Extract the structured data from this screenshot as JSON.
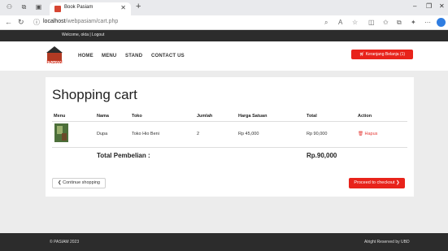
{
  "browser": {
    "tab_title": "Book Pasiam",
    "url_host": "localhost",
    "url_path": "/webpasiam/cart.php",
    "controls": {
      "minimize": "–",
      "restore": "❐",
      "close": "✕"
    }
  },
  "topbar": {
    "welcome": "Welcome, okta | Logout"
  },
  "nav": {
    "logo_text": "PASIAM",
    "menu": [
      "HOME",
      "MENU",
      "STAND",
      "CONTACT US"
    ],
    "cart_button": "Keranjang Belanja (1)"
  },
  "cart": {
    "title": "Shopping cart",
    "columns": [
      "Menu",
      "Nama",
      "Toko",
      "Jumlah",
      "Harga Satuan",
      "Total",
      "Action"
    ],
    "rows": [
      {
        "name": "Dupa",
        "store": "Toko Hio Beni",
        "qty": "2",
        "unit_price": "Rp 45,000",
        "total": "Rp 90,000",
        "action": "Hapus"
      }
    ],
    "total_label": "Total Pembelian :",
    "total_value": "Rp.90,000",
    "continue_button": "Continue shopping",
    "checkout_button": "Proceed to checkout"
  },
  "footer": {
    "left": "© PASIAM 2023",
    "right": "Alright Reserved by UBD"
  },
  "colors": {
    "accent": "#e8231b",
    "dark_bar": "#2c2c2c",
    "background": "#ececec"
  }
}
